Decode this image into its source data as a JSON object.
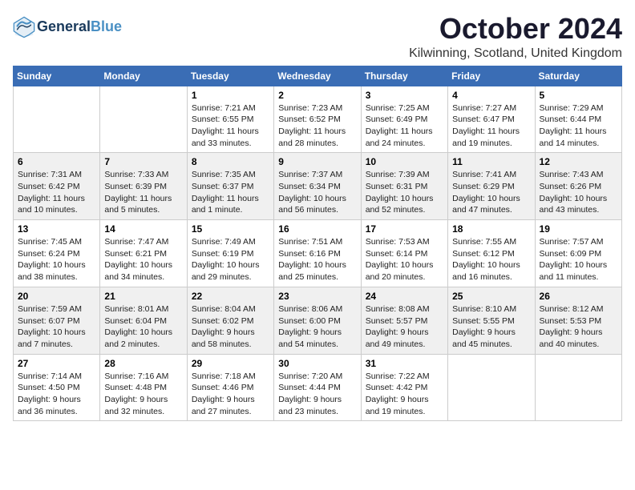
{
  "header": {
    "logo_line1": "General",
    "logo_line2": "Blue",
    "title": "October 2024",
    "subtitle": "Kilwinning, Scotland, United Kingdom"
  },
  "weekdays": [
    "Sunday",
    "Monday",
    "Tuesday",
    "Wednesday",
    "Thursday",
    "Friday",
    "Saturday"
  ],
  "weeks": [
    [
      {
        "day": "",
        "info": ""
      },
      {
        "day": "",
        "info": ""
      },
      {
        "day": "1",
        "info": "Sunrise: 7:21 AM\nSunset: 6:55 PM\nDaylight: 11 hours\nand 33 minutes."
      },
      {
        "day": "2",
        "info": "Sunrise: 7:23 AM\nSunset: 6:52 PM\nDaylight: 11 hours\nand 28 minutes."
      },
      {
        "day": "3",
        "info": "Sunrise: 7:25 AM\nSunset: 6:49 PM\nDaylight: 11 hours\nand 24 minutes."
      },
      {
        "day": "4",
        "info": "Sunrise: 7:27 AM\nSunset: 6:47 PM\nDaylight: 11 hours\nand 19 minutes."
      },
      {
        "day": "5",
        "info": "Sunrise: 7:29 AM\nSunset: 6:44 PM\nDaylight: 11 hours\nand 14 minutes."
      }
    ],
    [
      {
        "day": "6",
        "info": "Sunrise: 7:31 AM\nSunset: 6:42 PM\nDaylight: 11 hours\nand 10 minutes."
      },
      {
        "day": "7",
        "info": "Sunrise: 7:33 AM\nSunset: 6:39 PM\nDaylight: 11 hours\nand 5 minutes."
      },
      {
        "day": "8",
        "info": "Sunrise: 7:35 AM\nSunset: 6:37 PM\nDaylight: 11 hours\nand 1 minute."
      },
      {
        "day": "9",
        "info": "Sunrise: 7:37 AM\nSunset: 6:34 PM\nDaylight: 10 hours\nand 56 minutes."
      },
      {
        "day": "10",
        "info": "Sunrise: 7:39 AM\nSunset: 6:31 PM\nDaylight: 10 hours\nand 52 minutes."
      },
      {
        "day": "11",
        "info": "Sunrise: 7:41 AM\nSunset: 6:29 PM\nDaylight: 10 hours\nand 47 minutes."
      },
      {
        "day": "12",
        "info": "Sunrise: 7:43 AM\nSunset: 6:26 PM\nDaylight: 10 hours\nand 43 minutes."
      }
    ],
    [
      {
        "day": "13",
        "info": "Sunrise: 7:45 AM\nSunset: 6:24 PM\nDaylight: 10 hours\nand 38 minutes."
      },
      {
        "day": "14",
        "info": "Sunrise: 7:47 AM\nSunset: 6:21 PM\nDaylight: 10 hours\nand 34 minutes."
      },
      {
        "day": "15",
        "info": "Sunrise: 7:49 AM\nSunset: 6:19 PM\nDaylight: 10 hours\nand 29 minutes."
      },
      {
        "day": "16",
        "info": "Sunrise: 7:51 AM\nSunset: 6:16 PM\nDaylight: 10 hours\nand 25 minutes."
      },
      {
        "day": "17",
        "info": "Sunrise: 7:53 AM\nSunset: 6:14 PM\nDaylight: 10 hours\nand 20 minutes."
      },
      {
        "day": "18",
        "info": "Sunrise: 7:55 AM\nSunset: 6:12 PM\nDaylight: 10 hours\nand 16 minutes."
      },
      {
        "day": "19",
        "info": "Sunrise: 7:57 AM\nSunset: 6:09 PM\nDaylight: 10 hours\nand 11 minutes."
      }
    ],
    [
      {
        "day": "20",
        "info": "Sunrise: 7:59 AM\nSunset: 6:07 PM\nDaylight: 10 hours\nand 7 minutes."
      },
      {
        "day": "21",
        "info": "Sunrise: 8:01 AM\nSunset: 6:04 PM\nDaylight: 10 hours\nand 2 minutes."
      },
      {
        "day": "22",
        "info": "Sunrise: 8:04 AM\nSunset: 6:02 PM\nDaylight: 9 hours\nand 58 minutes."
      },
      {
        "day": "23",
        "info": "Sunrise: 8:06 AM\nSunset: 6:00 PM\nDaylight: 9 hours\nand 54 minutes."
      },
      {
        "day": "24",
        "info": "Sunrise: 8:08 AM\nSunset: 5:57 PM\nDaylight: 9 hours\nand 49 minutes."
      },
      {
        "day": "25",
        "info": "Sunrise: 8:10 AM\nSunset: 5:55 PM\nDaylight: 9 hours\nand 45 minutes."
      },
      {
        "day": "26",
        "info": "Sunrise: 8:12 AM\nSunset: 5:53 PM\nDaylight: 9 hours\nand 40 minutes."
      }
    ],
    [
      {
        "day": "27",
        "info": "Sunrise: 7:14 AM\nSunset: 4:50 PM\nDaylight: 9 hours\nand 36 minutes."
      },
      {
        "day": "28",
        "info": "Sunrise: 7:16 AM\nSunset: 4:48 PM\nDaylight: 9 hours\nand 32 minutes."
      },
      {
        "day": "29",
        "info": "Sunrise: 7:18 AM\nSunset: 4:46 PM\nDaylight: 9 hours\nand 27 minutes."
      },
      {
        "day": "30",
        "info": "Sunrise: 7:20 AM\nSunset: 4:44 PM\nDaylight: 9 hours\nand 23 minutes."
      },
      {
        "day": "31",
        "info": "Sunrise: 7:22 AM\nSunset: 4:42 PM\nDaylight: 9 hours\nand 19 minutes."
      },
      {
        "day": "",
        "info": ""
      },
      {
        "day": "",
        "info": ""
      }
    ]
  ]
}
